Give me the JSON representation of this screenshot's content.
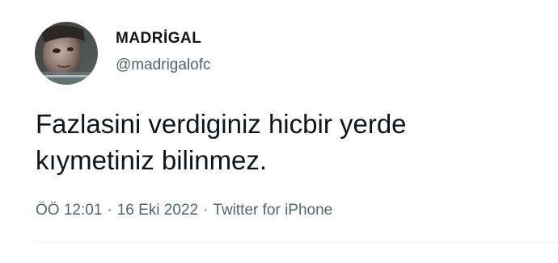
{
  "author": {
    "display_name": "MADRİGAL",
    "handle": "@madrigalofc",
    "avatar_icon": "profile-avatar"
  },
  "tweet": {
    "lines": [
      "Fazlasini verdiginiz hicbir yerde",
      "kıymetiniz bilinmez."
    ]
  },
  "meta": {
    "time": "ÖÖ 12:01",
    "separator": "·",
    "date": "16 Eki 2022",
    "source": "Twitter for iPhone"
  },
  "colors": {
    "primary_text": "#0f1419",
    "secondary_text": "#536471",
    "divider": "#eff3f4"
  }
}
